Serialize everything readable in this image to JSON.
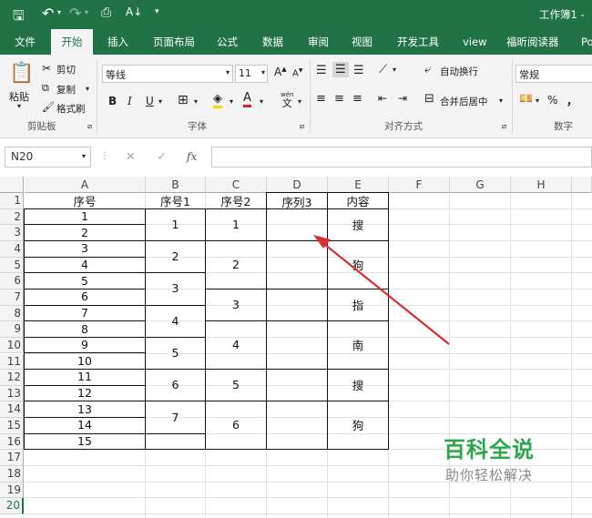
{
  "titlebar": {
    "doc_title": "工作簿1 -"
  },
  "tabs": [
    "文件",
    "开始",
    "插入",
    "页面布局",
    "公式",
    "数据",
    "审阅",
    "视图",
    "开发工具",
    "view",
    "福昕阅读器",
    "Po"
  ],
  "clipboard": {
    "paste": "粘贴",
    "cut": "剪切",
    "copy": "复制",
    "format_painter": "格式刷",
    "group": "剪贴板"
  },
  "font": {
    "name": "等线",
    "size": "11",
    "bold": "B",
    "italic": "I",
    "underline": "U",
    "group": "字体",
    "wen": "wén",
    "wen2": "文"
  },
  "alignment": {
    "wrap": "自动换行",
    "merge": "合并后居中",
    "group": "对齐方式"
  },
  "number": {
    "format": "常规",
    "percent": "%",
    "comma": "，",
    "group": "数字"
  },
  "formula_bar": {
    "name_box": "N20",
    "fx": "fx",
    "content": ""
  },
  "columns": [
    "A",
    "B",
    "C",
    "D",
    "E",
    "F",
    "G",
    "H"
  ],
  "rows": [
    "1",
    "2",
    "3",
    "4",
    "5",
    "6",
    "7",
    "8",
    "9",
    "10",
    "11",
    "12",
    "13",
    "14",
    "15",
    "16",
    "17",
    "18",
    "19",
    "20"
  ],
  "sheet": {
    "headers": {
      "A": "序号",
      "B": "序号1",
      "C": "序号2",
      "D": "序列3",
      "E": "内容"
    },
    "col_a": [
      "1",
      "2",
      "3",
      "4",
      "5",
      "6",
      "7",
      "8",
      "9",
      "10",
      "11",
      "12",
      "13",
      "14",
      "15"
    ],
    "col_b": [
      "1",
      "2",
      "3",
      "4",
      "5",
      "6",
      "7"
    ],
    "col_c": [
      "1",
      "2",
      "3",
      "4",
      "5",
      "6"
    ],
    "col_e": [
      "搜",
      "狗",
      "指",
      "南",
      "搜",
      "狗"
    ]
  },
  "watermark": {
    "title": "百科全说",
    "subtitle": "助你轻松解决"
  },
  "colors": {
    "accent": "#217346",
    "arrow": "#d9302e",
    "watermark": "#2aa84a"
  }
}
